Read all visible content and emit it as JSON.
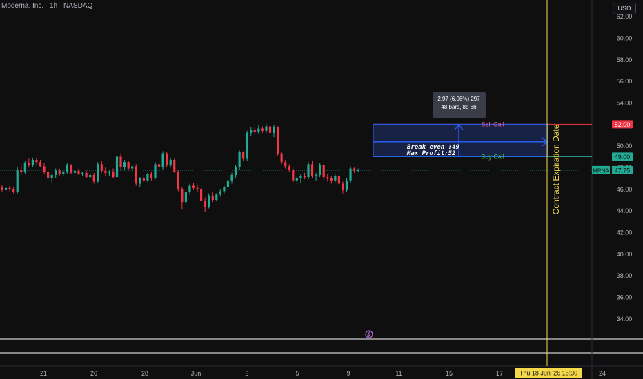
{
  "header": {
    "title": "Moderna, Inc. · 1h · NASDAQ",
    "currency_button": "USD"
  },
  "chart_data": {
    "type": "candlestick",
    "symbol": "MRNA",
    "last_price": "47.75",
    "ylim": [
      33,
      62.5
    ],
    "y_ticks": [
      "34.00",
      "36.00",
      "38.00",
      "40.00",
      "42.00",
      "44.00",
      "46.00",
      "48.00",
      "50.00",
      "52.00",
      "54.00",
      "56.00",
      "58.00",
      "60.00",
      "62.00"
    ],
    "x_ticks": [
      "21",
      "26",
      "28",
      "Jun",
      "3",
      "5",
      "9",
      "11",
      "15",
      "17",
      "24"
    ],
    "crosshair_date_label": "Thu 18 Jun '26   15:30",
    "grid": false,
    "candles": [
      [
        46.2,
        46.4,
        45.7,
        45.9
      ],
      [
        45.9,
        46.2,
        45.7,
        46.1
      ],
      [
        46.1,
        46.3,
        45.8,
        46.0
      ],
      [
        46.0,
        46.2,
        45.6,
        45.7
      ],
      [
        45.7,
        48.0,
        45.6,
        47.8
      ],
      [
        47.8,
        48.3,
        47.3,
        47.6
      ],
      [
        47.6,
        48.6,
        47.4,
        48.4
      ],
      [
        48.4,
        48.8,
        48.0,
        48.2
      ],
      [
        48.2,
        48.9,
        48.0,
        48.7
      ],
      [
        48.7,
        48.9,
        48.3,
        48.5
      ],
      [
        48.5,
        48.7,
        48.0,
        48.1
      ],
      [
        48.1,
        48.4,
        47.4,
        47.6
      ],
      [
        47.6,
        47.8,
        46.8,
        47.0
      ],
      [
        47.0,
        47.4,
        46.6,
        47.3
      ],
      [
        47.3,
        47.9,
        47.0,
        47.7
      ],
      [
        47.7,
        47.9,
        47.2,
        47.4
      ],
      [
        47.4,
        47.8,
        47.2,
        47.6
      ],
      [
        47.6,
        48.4,
        47.4,
        48.2
      ],
      [
        48.2,
        48.3,
        47.4,
        47.5
      ],
      [
        47.5,
        47.8,
        47.3,
        47.7
      ],
      [
        47.7,
        47.9,
        47.3,
        47.4
      ],
      [
        47.4,
        47.6,
        47.2,
        47.5
      ],
      [
        47.5,
        47.7,
        47.0,
        47.1
      ],
      [
        47.1,
        47.5,
        47.0,
        47.3
      ],
      [
        47.3,
        47.5,
        46.5,
        46.7
      ],
      [
        46.7,
        48.5,
        46.6,
        48.3
      ],
      [
        48.3,
        48.6,
        47.5,
        47.7
      ],
      [
        47.7,
        48.0,
        47.2,
        47.5
      ],
      [
        47.5,
        47.8,
        47.2,
        47.6
      ],
      [
        47.6,
        47.9,
        47.0,
        47.1
      ],
      [
        47.1,
        49.2,
        47.0,
        49.0
      ],
      [
        49.0,
        49.3,
        47.8,
        48.0
      ],
      [
        48.0,
        48.7,
        47.8,
        48.5
      ],
      [
        48.5,
        48.6,
        47.8,
        47.9
      ],
      [
        47.9,
        48.2,
        47.6,
        48.1
      ],
      [
        48.1,
        48.3,
        46.3,
        46.5
      ],
      [
        46.5,
        47.1,
        46.2,
        47.0
      ],
      [
        47.0,
        47.3,
        46.6,
        46.8
      ],
      [
        46.8,
        47.5,
        46.7,
        47.4
      ],
      [
        47.4,
        47.6,
        46.8,
        47.0
      ],
      [
        47.0,
        48.5,
        46.9,
        48.3
      ],
      [
        48.3,
        48.8,
        47.8,
        48.0
      ],
      [
        48.0,
        49.5,
        47.8,
        49.3
      ],
      [
        49.3,
        49.4,
        48.0,
        48.2
      ],
      [
        48.2,
        48.9,
        48.0,
        48.7
      ],
      [
        48.7,
        48.8,
        47.5,
        47.6
      ],
      [
        47.6,
        47.8,
        45.8,
        46.0
      ],
      [
        46.0,
        46.2,
        44.1,
        44.8
      ],
      [
        44.8,
        45.9,
        44.6,
        45.7
      ],
      [
        45.7,
        46.5,
        45.5,
        46.3
      ],
      [
        46.3,
        46.6,
        45.9,
        46.1
      ],
      [
        46.1,
        46.4,
        45.7,
        46.0
      ],
      [
        46.0,
        46.2,
        44.7,
        44.9
      ],
      [
        44.9,
        45.2,
        43.9,
        44.3
      ],
      [
        44.3,
        45.6,
        44.2,
        45.4
      ],
      [
        45.4,
        45.7,
        44.8,
        45.0
      ],
      [
        45.0,
        45.6,
        44.9,
        45.5
      ],
      [
        45.5,
        46.0,
        45.3,
        45.8
      ],
      [
        45.8,
        46.3,
        45.6,
        46.2
      ],
      [
        46.2,
        47.0,
        46.0,
        46.8
      ],
      [
        46.8,
        47.5,
        46.5,
        47.3
      ],
      [
        47.3,
        48.2,
        47.0,
        48.0
      ],
      [
        48.0,
        49.6,
        47.8,
        49.4
      ],
      [
        49.4,
        49.5,
        48.6,
        48.8
      ],
      [
        48.8,
        51.4,
        48.6,
        51.2
      ],
      [
        51.2,
        51.7,
        50.9,
        51.5
      ],
      [
        51.5,
        51.8,
        51.0,
        51.3
      ],
      [
        51.3,
        51.9,
        51.1,
        51.6
      ],
      [
        51.6,
        51.8,
        51.2,
        51.4
      ],
      [
        51.4,
        52.0,
        51.2,
        51.8
      ],
      [
        51.8,
        52.0,
        51.0,
        51.2
      ],
      [
        51.2,
        51.9,
        50.8,
        51.7
      ],
      [
        51.7,
        51.8,
        49.1,
        49.3
      ],
      [
        49.3,
        49.4,
        48.3,
        48.5
      ],
      [
        48.5,
        48.7,
        47.9,
        48.1
      ],
      [
        48.1,
        48.3,
        47.6,
        47.8
      ],
      [
        47.8,
        48.1,
        46.6,
        46.8
      ],
      [
        46.8,
        47.2,
        46.4,
        47.0
      ],
      [
        47.0,
        47.4,
        46.6,
        47.2
      ],
      [
        47.2,
        47.5,
        46.9,
        47.1
      ],
      [
        47.1,
        48.5,
        46.9,
        48.3
      ],
      [
        48.3,
        48.6,
        47.0,
        47.2
      ],
      [
        47.2,
        47.5,
        46.8,
        47.3
      ],
      [
        47.3,
        48.4,
        47.1,
        48.2
      ],
      [
        48.2,
        48.3,
        46.9,
        47.1
      ],
      [
        47.1,
        47.4,
        46.7,
        47.0
      ],
      [
        47.0,
        47.2,
        46.5,
        46.8
      ],
      [
        46.8,
        47.4,
        46.6,
        47.2
      ],
      [
        47.2,
        47.3,
        46.3,
        46.5
      ],
      [
        46.5,
        46.7,
        45.6,
        45.9
      ],
      [
        45.9,
        47.0,
        45.7,
        46.8
      ],
      [
        46.8,
        48.1,
        46.6,
        47.9
      ],
      [
        47.9,
        48.0,
        47.5,
        47.7
      ],
      [
        47.7,
        47.9,
        47.6,
        47.75
      ]
    ],
    "levels": [
      {
        "name": "Sell Call",
        "price": 52.0,
        "tag": "52.00",
        "color": "#f23645"
      },
      {
        "name": "Buy Call",
        "price": 49.0,
        "tag": "49.00",
        "color": "#22ab94"
      }
    ],
    "annotations": {
      "break_even": "Break even :49",
      "max_profit": "Max Profit:52",
      "range_tooltip_line1": "2.97 (6.06%) 297",
      "range_tooltip_line2": "48 bars, 8d 6h",
      "expiration_label": "Contract Expiration Date"
    },
    "colors": {
      "up": "#22ab94",
      "down": "#f23645",
      "background": "#0f0f10",
      "box_fill": "#1b2a55",
      "box_border": "#2962ff",
      "expiration": "#f5d84a",
      "axis_text": "#b2b5be"
    }
  }
}
